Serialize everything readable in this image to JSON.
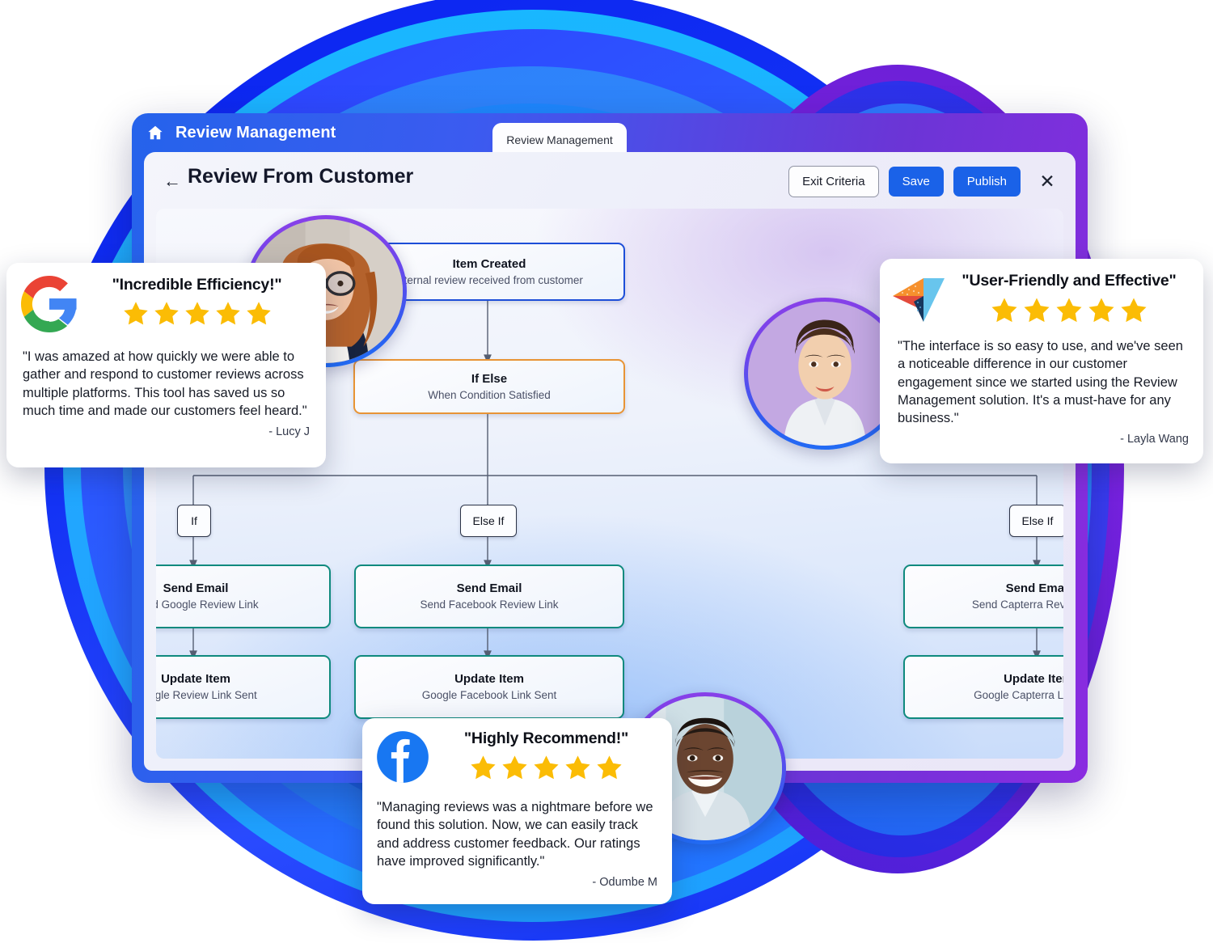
{
  "window": {
    "home_icon": "home-icon",
    "app_title": "Review Management",
    "tab_label": "Review Management",
    "back_icon": "back-arrow-icon",
    "panel_title": "Review From Customer",
    "buttons": {
      "exit_criteria": "Exit Criteria",
      "save": "Save",
      "publish": "Publish",
      "close": "×"
    },
    "accent_primary": "#1a62e8",
    "frame_gradient_from": "#2563eb",
    "frame_gradient_to": "#8a2be0"
  },
  "flow": {
    "trigger": {
      "title": "Item Created",
      "subtitle": "internal review received from customer",
      "border_color": "#1d4ed8"
    },
    "condition": {
      "title": "If Else",
      "subtitle": "When Condition Satisfied",
      "border_color": "#e89435"
    },
    "branches": [
      {
        "label": "If",
        "email": {
          "title": "Send Email",
          "subtitle": "Send Google Review Link"
        },
        "update": {
          "title": "Update Item",
          "subtitle": "Google Review Link Sent"
        }
      },
      {
        "label": "Else If",
        "email": {
          "title": "Send Email",
          "subtitle": "Send Facebook Review Link"
        },
        "update": {
          "title": "Update Item",
          "subtitle": "Google Facebook Link Sent"
        }
      },
      {
        "label": "Else If",
        "email": {
          "title": "Send Email",
          "subtitle": "Send Capterra Review Link"
        },
        "update": {
          "title": "Update Item",
          "subtitle": "Google Capterra Link Sent"
        }
      }
    ],
    "action_border_color": "#0f8a7e"
  },
  "testimonials": [
    {
      "id": "google",
      "logo": "google-logo",
      "title": "\"Incredible Efficiency!\"",
      "rating": 5,
      "body": "\"I was amazed at how quickly we were able to gather and respond to customer reviews across multiple platforms. This tool has saved us so much time and made our customers feel heard.\"",
      "author": "- Lucy J"
    },
    {
      "id": "capterra",
      "logo": "capterra-logo",
      "title": "\"User-Friendly and Effective\"",
      "rating": 5,
      "body": "\"The interface is so easy to use, and we've seen a noticeable difference in our customer engagement since we started using the Review Management solution. It's a must-have for any business.\"",
      "author": "- Layla Wang"
    },
    {
      "id": "facebook",
      "logo": "facebook-logo",
      "title": "\"Highly Recommend!\"",
      "rating": 5,
      "body": "\"Managing reviews was a nightmare before we found this solution. Now, we can easily track and address customer feedback. Our ratings have improved significantly.\"",
      "author": "- Odumbe M"
    }
  ],
  "avatars": [
    {
      "id": "avatar-woman-glasses",
      "alt": "smiling woman with glasses"
    },
    {
      "id": "avatar-woman-shirt",
      "alt": "smiling woman in white shirt"
    },
    {
      "id": "avatar-man-smiling",
      "alt": "smiling man"
    }
  ],
  "colors": {
    "star": "#fbbc05",
    "ring_blue": "#0a23f0",
    "ring_cyan": "#19b7ff",
    "ring_purple": "#7a22e0"
  }
}
